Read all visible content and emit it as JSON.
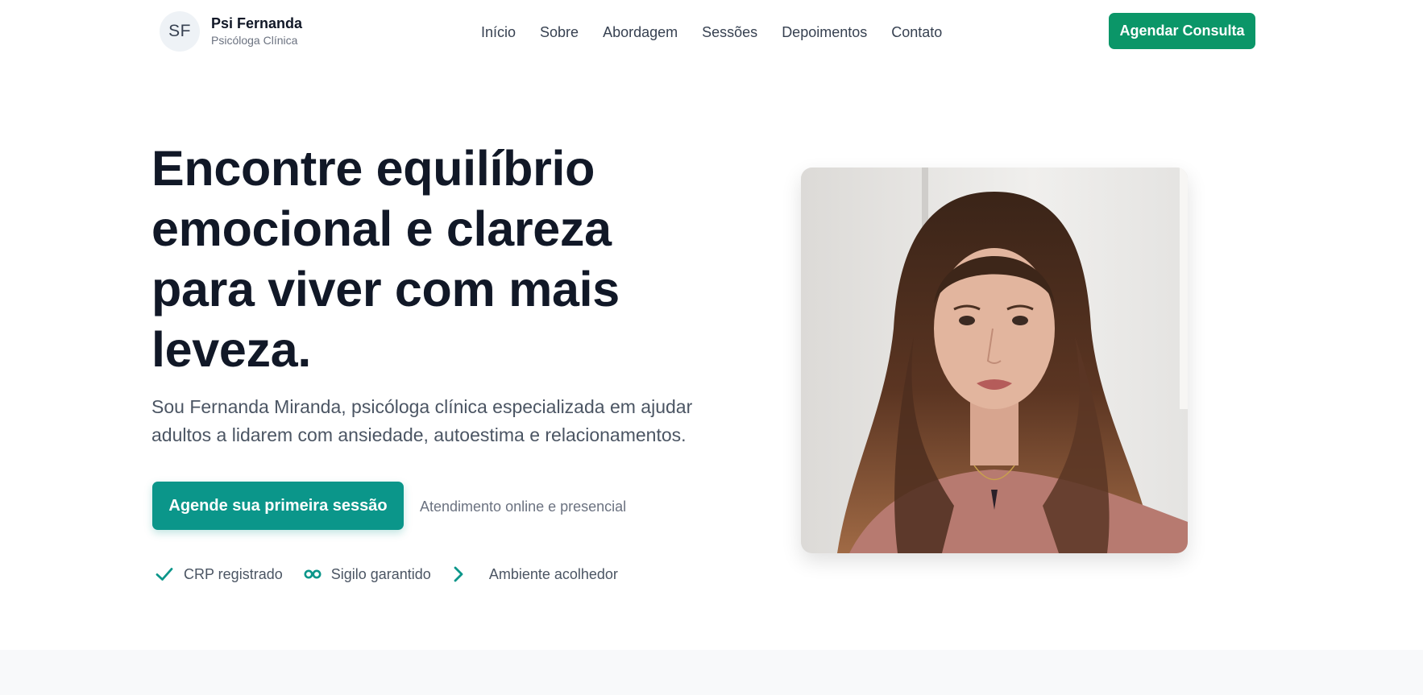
{
  "brand": {
    "initials": "SF",
    "name": "Psi Fernanda",
    "subtitle": "Psicóloga Clínica"
  },
  "nav": {
    "items": [
      {
        "label": "Início"
      },
      {
        "label": "Sobre"
      },
      {
        "label": "Abordagem"
      },
      {
        "label": "Sessões"
      },
      {
        "label": "Depoimentos"
      },
      {
        "label": "Contato"
      }
    ]
  },
  "header": {
    "cta_label": "Agendar Consulta"
  },
  "hero": {
    "title": "Encontre equilíbrio emocional e clareza para viver com mais leveza.",
    "subtitle": "Sou Fernanda Miranda, psicóloga clínica especializada em ajudar adultos a lidarem com ansiedade, autoestima e relacionamentos.",
    "cta_label": "Agende sua primeira sessão",
    "cta_note": "Atendimento online e presencial",
    "features": [
      {
        "icon": "check-icon",
        "label": "CRP registrado"
      },
      {
        "icon": "infinity-icon",
        "label": "Sigilo garantido"
      },
      {
        "icon": "chevron-right-icon",
        "label": "Ambiente acolhedor"
      }
    ]
  },
  "colors": {
    "brand_green": "#0b9668",
    "teal": "#0b968a",
    "text_dark": "#111827",
    "text_muted": "#4b5563"
  }
}
